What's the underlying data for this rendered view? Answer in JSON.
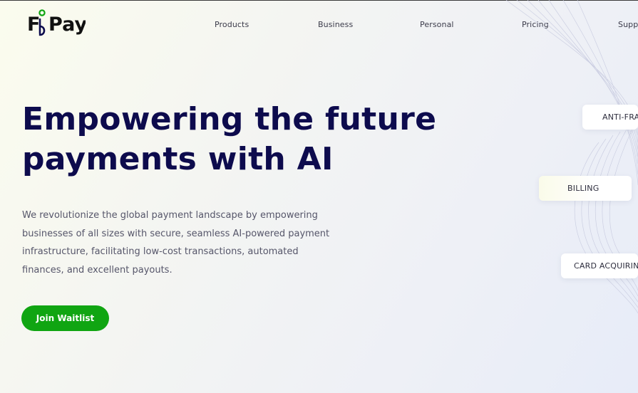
{
  "brand": {
    "name": "FinPay",
    "wordmark_left": "F",
    "wordmark_right": "Pay",
    "accent": "#10a512",
    "navy": "#0d0b4d"
  },
  "nav": {
    "items": [
      {
        "label": "Products"
      },
      {
        "label": "Business"
      },
      {
        "label": "Personal"
      },
      {
        "label": "Pricing"
      },
      {
        "label": "Supp"
      }
    ]
  },
  "hero": {
    "title_line1": "Empowering the future",
    "title_line2": "payments with AI",
    "description": "We revolutionize the global payment landscape by empowering businesses of all sizes with secure, seamless AI-powered payment infrastructure, facilitating low-cost transactions, automated finances, and excellent payouts.",
    "cta_label": "Join Waitlist"
  },
  "feature_tags": [
    {
      "label": "ANTI-FRAU"
    },
    {
      "label": "BILLING"
    },
    {
      "label": "CARD ACQUIRING"
    }
  ]
}
